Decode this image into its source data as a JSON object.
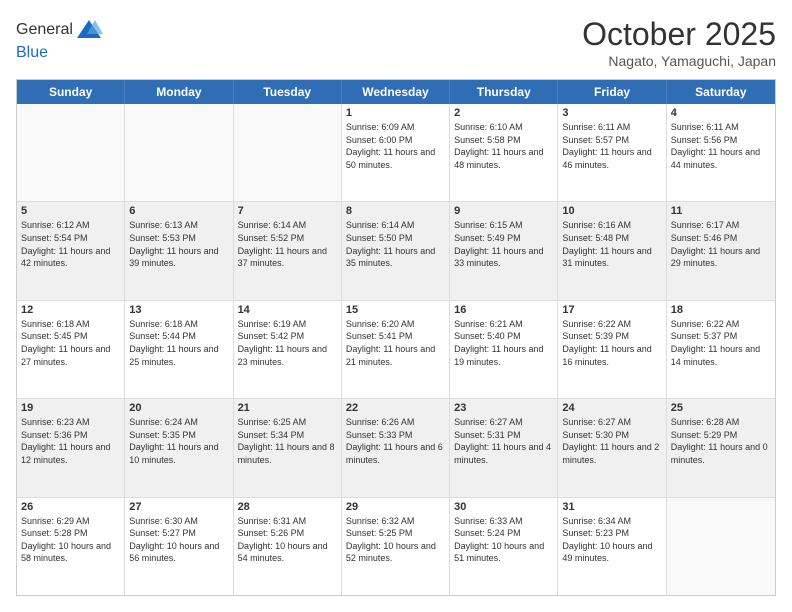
{
  "header": {
    "logo": {
      "line1": "General",
      "line2": "Blue"
    },
    "title": "October 2025",
    "location": "Nagato, Yamaguchi, Japan"
  },
  "days_of_week": [
    "Sunday",
    "Monday",
    "Tuesday",
    "Wednesday",
    "Thursday",
    "Friday",
    "Saturday"
  ],
  "weeks": [
    [
      {
        "num": "",
        "info": "",
        "empty": true
      },
      {
        "num": "",
        "info": "",
        "empty": true
      },
      {
        "num": "",
        "info": "",
        "empty": true
      },
      {
        "num": "1",
        "info": "Sunrise: 6:09 AM\nSunset: 6:00 PM\nDaylight: 11 hours and 50 minutes."
      },
      {
        "num": "2",
        "info": "Sunrise: 6:10 AM\nSunset: 5:58 PM\nDaylight: 11 hours and 48 minutes."
      },
      {
        "num": "3",
        "info": "Sunrise: 6:11 AM\nSunset: 5:57 PM\nDaylight: 11 hours and 46 minutes."
      },
      {
        "num": "4",
        "info": "Sunrise: 6:11 AM\nSunset: 5:56 PM\nDaylight: 11 hours and 44 minutes."
      }
    ],
    [
      {
        "num": "5",
        "info": "Sunrise: 6:12 AM\nSunset: 5:54 PM\nDaylight: 11 hours and 42 minutes."
      },
      {
        "num": "6",
        "info": "Sunrise: 6:13 AM\nSunset: 5:53 PM\nDaylight: 11 hours and 39 minutes."
      },
      {
        "num": "7",
        "info": "Sunrise: 6:14 AM\nSunset: 5:52 PM\nDaylight: 11 hours and 37 minutes."
      },
      {
        "num": "8",
        "info": "Sunrise: 6:14 AM\nSunset: 5:50 PM\nDaylight: 11 hours and 35 minutes."
      },
      {
        "num": "9",
        "info": "Sunrise: 6:15 AM\nSunset: 5:49 PM\nDaylight: 11 hours and 33 minutes."
      },
      {
        "num": "10",
        "info": "Sunrise: 6:16 AM\nSunset: 5:48 PM\nDaylight: 11 hours and 31 minutes."
      },
      {
        "num": "11",
        "info": "Sunrise: 6:17 AM\nSunset: 5:46 PM\nDaylight: 11 hours and 29 minutes."
      }
    ],
    [
      {
        "num": "12",
        "info": "Sunrise: 6:18 AM\nSunset: 5:45 PM\nDaylight: 11 hours and 27 minutes."
      },
      {
        "num": "13",
        "info": "Sunrise: 6:18 AM\nSunset: 5:44 PM\nDaylight: 11 hours and 25 minutes."
      },
      {
        "num": "14",
        "info": "Sunrise: 6:19 AM\nSunset: 5:42 PM\nDaylight: 11 hours and 23 minutes."
      },
      {
        "num": "15",
        "info": "Sunrise: 6:20 AM\nSunset: 5:41 PM\nDaylight: 11 hours and 21 minutes."
      },
      {
        "num": "16",
        "info": "Sunrise: 6:21 AM\nSunset: 5:40 PM\nDaylight: 11 hours and 19 minutes."
      },
      {
        "num": "17",
        "info": "Sunrise: 6:22 AM\nSunset: 5:39 PM\nDaylight: 11 hours and 16 minutes."
      },
      {
        "num": "18",
        "info": "Sunrise: 6:22 AM\nSunset: 5:37 PM\nDaylight: 11 hours and 14 minutes."
      }
    ],
    [
      {
        "num": "19",
        "info": "Sunrise: 6:23 AM\nSunset: 5:36 PM\nDaylight: 11 hours and 12 minutes."
      },
      {
        "num": "20",
        "info": "Sunrise: 6:24 AM\nSunset: 5:35 PM\nDaylight: 11 hours and 10 minutes."
      },
      {
        "num": "21",
        "info": "Sunrise: 6:25 AM\nSunset: 5:34 PM\nDaylight: 11 hours and 8 minutes."
      },
      {
        "num": "22",
        "info": "Sunrise: 6:26 AM\nSunset: 5:33 PM\nDaylight: 11 hours and 6 minutes."
      },
      {
        "num": "23",
        "info": "Sunrise: 6:27 AM\nSunset: 5:31 PM\nDaylight: 11 hours and 4 minutes."
      },
      {
        "num": "24",
        "info": "Sunrise: 6:27 AM\nSunset: 5:30 PM\nDaylight: 11 hours and 2 minutes."
      },
      {
        "num": "25",
        "info": "Sunrise: 6:28 AM\nSunset: 5:29 PM\nDaylight: 11 hours and 0 minutes."
      }
    ],
    [
      {
        "num": "26",
        "info": "Sunrise: 6:29 AM\nSunset: 5:28 PM\nDaylight: 10 hours and 58 minutes."
      },
      {
        "num": "27",
        "info": "Sunrise: 6:30 AM\nSunset: 5:27 PM\nDaylight: 10 hours and 56 minutes."
      },
      {
        "num": "28",
        "info": "Sunrise: 6:31 AM\nSunset: 5:26 PM\nDaylight: 10 hours and 54 minutes."
      },
      {
        "num": "29",
        "info": "Sunrise: 6:32 AM\nSunset: 5:25 PM\nDaylight: 10 hours and 52 minutes."
      },
      {
        "num": "30",
        "info": "Sunrise: 6:33 AM\nSunset: 5:24 PM\nDaylight: 10 hours and 51 minutes."
      },
      {
        "num": "31",
        "info": "Sunrise: 6:34 AM\nSunset: 5:23 PM\nDaylight: 10 hours and 49 minutes."
      },
      {
        "num": "",
        "info": "",
        "empty": true
      }
    ]
  ]
}
